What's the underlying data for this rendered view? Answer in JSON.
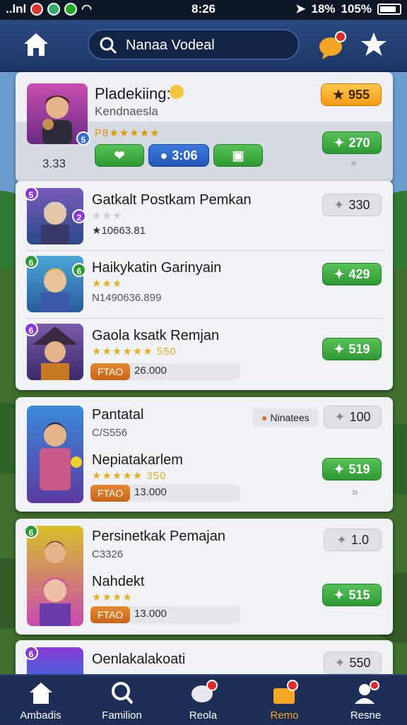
{
  "status_bar": {
    "left": "..lnl",
    "time": "8:26",
    "battery_pct": "18%",
    "battery2": "105%"
  },
  "header": {
    "search_text": "Nanaa Vodeal"
  },
  "featured": {
    "title": "Pladekiing:",
    "subtitle": "Kendnaesla",
    "rating_label": "P8★★★★★",
    "score": "3.33",
    "coins": "955",
    "timer": "3:06",
    "price": "270"
  },
  "list_a": [
    {
      "title": "Gatkalt Postkam Pemkan",
      "stat": "★10663.81",
      "price": "330",
      "price_style": "gray"
    },
    {
      "title": "Haikykatin Garinyain",
      "stat": "N1490636.899",
      "price": "429",
      "price_style": "green"
    },
    {
      "title": "Gaola ksatk Remjan",
      "stars_text": "★★★★★★ 550",
      "tag": "FTAO",
      "tag_value": "26.000",
      "price": "519",
      "price_style": "green"
    }
  ],
  "card_b": {
    "title": "Pantatal",
    "sub": "C/S556",
    "chip": "Ninatees",
    "price_top": "100",
    "title2": "Nepiatakarlem",
    "stars_text": "★★★★★ 350",
    "tag": "FTAO",
    "tag_value": "13.000",
    "price": "519"
  },
  "card_c": {
    "title": "Persinetkak Pemajan",
    "sub": "C3326",
    "price_top": "1.0",
    "title2": "Nahdekt",
    "stars_text": "★★★★",
    "tag": "FTAO",
    "tag_value": "13.000",
    "price": "515"
  },
  "card_d": {
    "title": "Oenlakalakoati",
    "price": "550"
  },
  "bottom_nav": [
    {
      "label": "Ambadis",
      "icon": "home-icon"
    },
    {
      "label": "Familion",
      "icon": "search-icon"
    },
    {
      "label": "Reola",
      "icon": "chat-icon"
    },
    {
      "label": "Remo",
      "icon": "mail-icon",
      "active": true
    },
    {
      "label": "Resne",
      "icon": "profile-icon"
    }
  ],
  "colors": {
    "accent_green": "#3aa83a",
    "accent_orange": "#f5a623",
    "header_blue": "#1d3566"
  }
}
